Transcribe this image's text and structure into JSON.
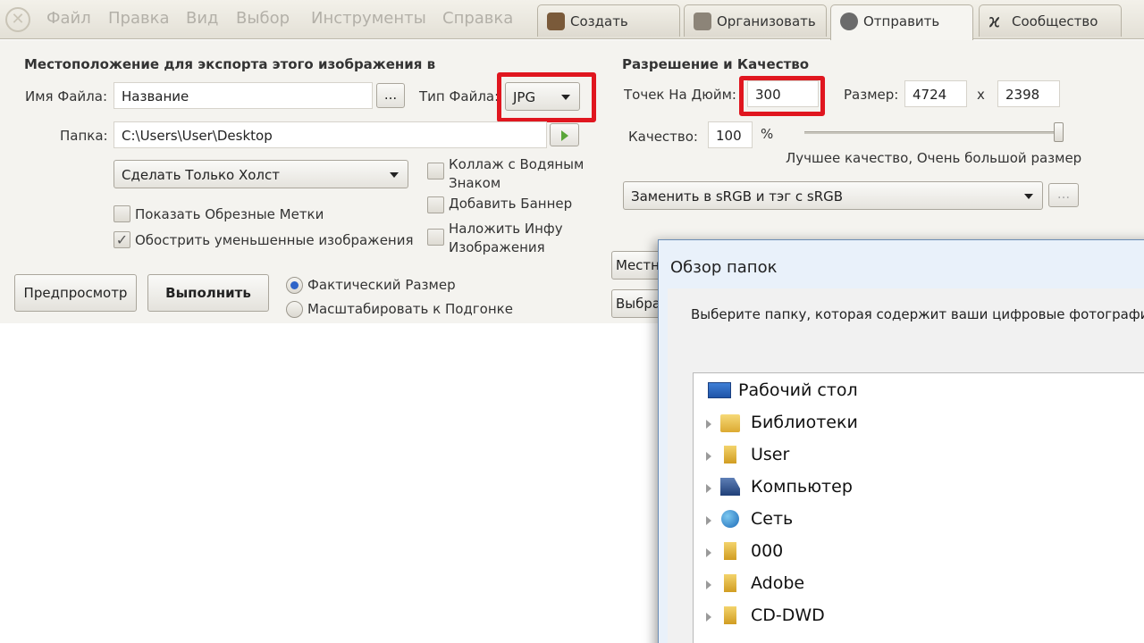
{
  "menu": {
    "items": [
      "Файл",
      "Правка",
      "Вид",
      "Выбор",
      "Инструменты",
      "Справка"
    ],
    "tabs": [
      {
        "label": "Создать",
        "icon": "create-icon"
      },
      {
        "label": "Организовать",
        "icon": "organize-icon"
      },
      {
        "label": "Отправить",
        "icon": "share-icon"
      },
      {
        "label": "Сообщество",
        "icon": "community-icon"
      }
    ]
  },
  "export": {
    "section_title": "Местоположение для экспорта этого изображения в",
    "filename_label": "Имя Файла:",
    "filename_value": "Название",
    "browse_label": "...",
    "filetype_label": "Тип Файла:",
    "filetype_value": "JPG",
    "folder_label": "Папка:",
    "folder_value": "C:\\Users\\User\\Desktop",
    "canvas_option": "Сделать Только Холст",
    "show_crop_marks": "Показать Обрезные Метки",
    "sharpen": "Обострить уменьшенные изображения",
    "collage_line1": "Коллаж с Водяным",
    "collage_line2": "Знаком",
    "add_banner": "Добавить Баннер",
    "overlay_line1": "Наложить Инфу",
    "overlay_line2": "Изображения",
    "preview_button": "Предпросмотр",
    "run_button": "Выполнить",
    "actual_size": "Фактический Размер",
    "scale_to_fit": "Масштабировать к Подгонке"
  },
  "resolution": {
    "section_title": "Разрешение и Качество",
    "dpi_label": "Точек На Дюйм:",
    "dpi_value": "300",
    "size_label": "Размер:",
    "width_value": "4724",
    "x_label": "x",
    "height_value": "2398",
    "quality_label": "Качество:",
    "quality_value": "100",
    "percent": "%",
    "quality_slider_level": 1.0,
    "quality_hint": "Лучшее качество, Очень большой размер",
    "color_option": "Заменить в sRGB и тэг с sRGB",
    "more_button": "...",
    "partial_button1": "Местн",
    "partial_button2": "Выбра"
  },
  "dialog": {
    "title": "Обзор папок",
    "instruction": "Выберите папку, которая содержит ваши цифровые фотографи",
    "tree": [
      {
        "label": "Рабочий стол",
        "icon": "desktop-icon"
      },
      {
        "label": "Библиотеки",
        "icon": "libraries-icon"
      },
      {
        "label": "User",
        "icon": "user-icon"
      },
      {
        "label": "Компьютер",
        "icon": "computer-icon"
      },
      {
        "label": "Сеть",
        "icon": "network-icon"
      },
      {
        "label": "000",
        "icon": "folder-icon"
      },
      {
        "label": "Adobe",
        "icon": "folder-icon"
      },
      {
        "label": "CD-DWD",
        "icon": "folder-icon"
      }
    ]
  },
  "colors": {
    "highlight": "#e0161f",
    "radio_accent": "#2f64c8"
  }
}
